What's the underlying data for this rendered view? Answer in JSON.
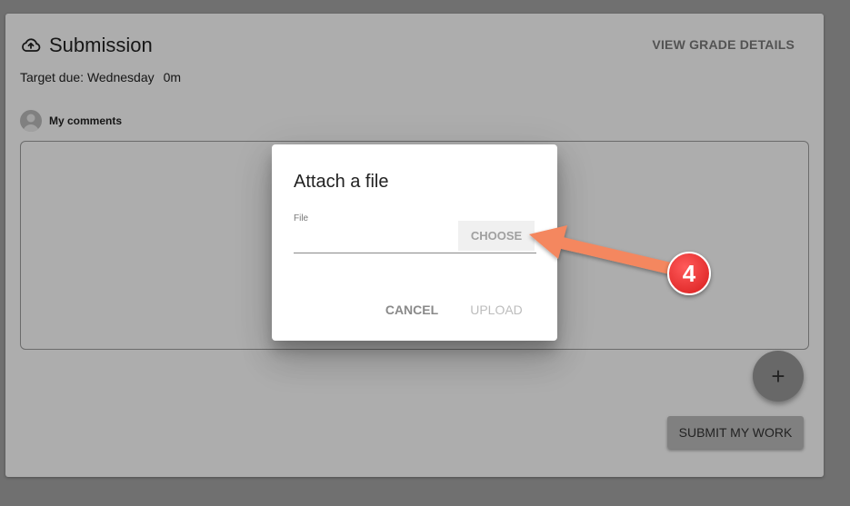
{
  "submission": {
    "title": "Submission",
    "view_grade_label": "VIEW GRADE DETAILS",
    "due_label": "Target due: Wednesday",
    "due_time": "0m",
    "comments_label": "My comments",
    "add_label": "+",
    "submit_label": "SUBMIT MY WORK"
  },
  "dialog": {
    "title": "Attach a file",
    "file_label": "File",
    "file_value": "",
    "choose_label": "CHOOSE",
    "cancel_label": "CANCEL",
    "upload_label": "UPLOAD"
  },
  "annotation": {
    "step_number": "4",
    "badge_color": "#e32626",
    "arrow_color": "#f4875f"
  },
  "icons": {
    "header": "cloud-upload-icon",
    "avatar": "person-icon"
  }
}
